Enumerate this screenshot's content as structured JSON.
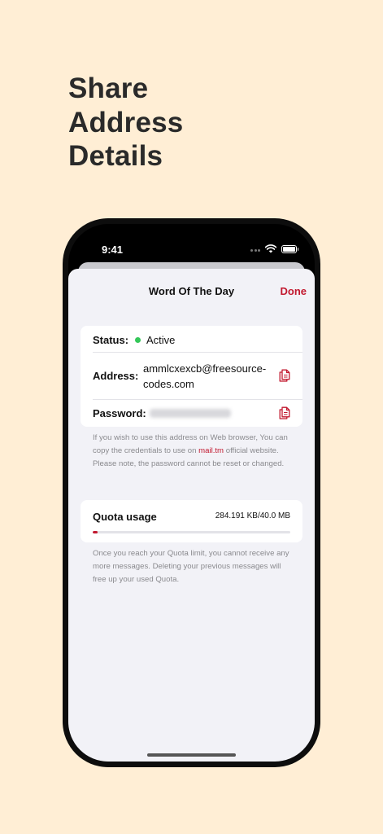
{
  "headline": [
    "Share",
    "Address",
    "Details"
  ],
  "status_bar": {
    "time": "9:41"
  },
  "sheet": {
    "title": "Word Of The Day",
    "done_label": "Done"
  },
  "info": {
    "status_label": "Status:",
    "status_value": "Active",
    "address_label": "Address:",
    "address_value": "ammlcxexcb@freesource-codes.com",
    "password_label": "Password:"
  },
  "note1": {
    "before": "If you wish to use this address on Web browser, You can copy the credentials to use on ",
    "link": "mail.tm",
    "after": " official website. Please note, the password cannot be reset or changed."
  },
  "quota": {
    "label": "Quota usage",
    "value": "284.191 KB/40.0 MB",
    "fraction": 0.0069
  },
  "note2": "Once you reach your Quota limit, you cannot receive any more messages. Deleting your previous messages will free up your used Quota.",
  "colors": {
    "background": "#FFEED5",
    "accent": "#C2192F",
    "status_active": "#34C759"
  }
}
